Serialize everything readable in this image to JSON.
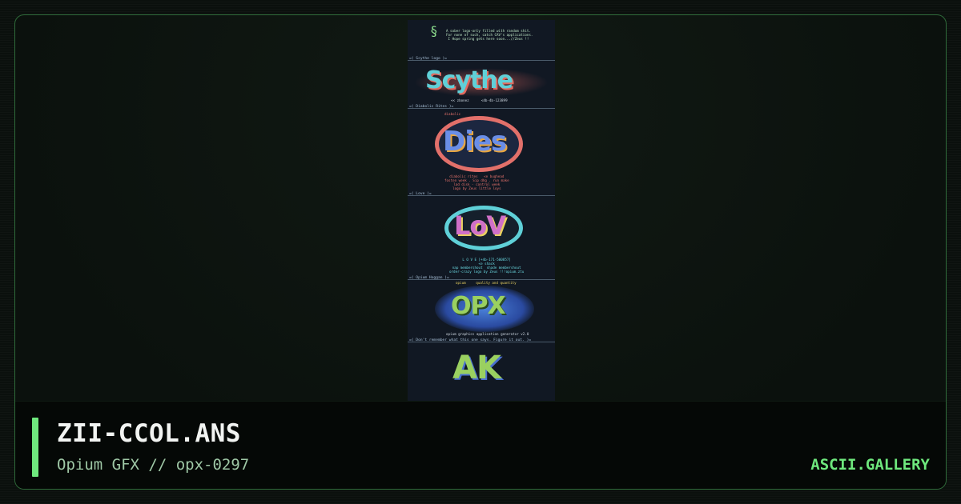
{
  "art": {
    "header_text": "A sober logo-only filled with random shit.\nFor none of such, catch CAV's applications.\n I Hope spring gets here soon...//Zeus !!",
    "sections": [
      {
        "label": "=( Scythe logo )=",
        "logo_text": "Scythe",
        "caption": "<< zbonez      <4b-4b-123899"
      },
      {
        "label": "=( Diabolic Rites )=",
        "tag": "diabolic",
        "logo_text": "Dies",
        "caption": "diabolic rites   <e bughead\nfosten week . Sip dhg . run make\nlad disk - control week\nlogo by Zeus little loys"
      },
      {
        "label": "=( Love )=",
        "logo_text": "LoV",
        "caption": "L O V E [+4b-171-500857]\n<e shack\nnap membershout  shade membershout\norder-crazy logo by Zeus !!!opium.ztu"
      },
      {
        "label": "=( Opium Hoggan )=",
        "tag": "opium     quality and quantity",
        "logo_text": "OPX",
        "caption": "opium graphics application generator v2.0"
      },
      {
        "label": "=( Don't remember what this one says. Figure it out. )=",
        "logo_text": "AK"
      }
    ]
  },
  "footer": {
    "filename": "ZII-CCOL.ANS",
    "subtitle": "Opium GFX // opx-0297",
    "site": "ASCII.GALLERY"
  },
  "colors": {
    "accent": "#6ee87d",
    "frame_border": "#2f6b3a",
    "preview_bg": "#111823"
  }
}
